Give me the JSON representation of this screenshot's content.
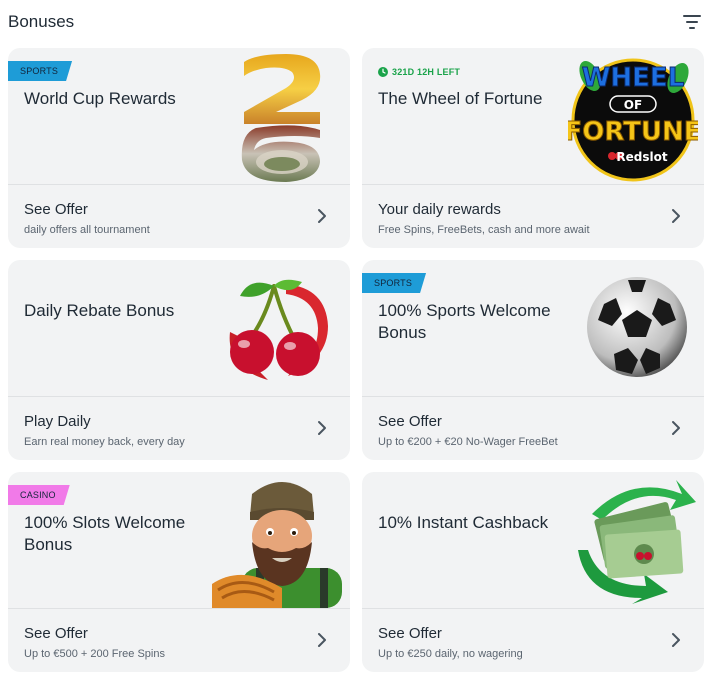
{
  "page": {
    "title": "Bonuses"
  },
  "icons": {
    "filter": "filter-icon",
    "chevron": "chevron-right-icon",
    "clock": "clock-icon"
  },
  "colors": {
    "sports_tag": "#1e9cd7",
    "casino_tag": "#f17ae8",
    "timer": "#1aa34a",
    "card_bg": "#f2f3f4"
  },
  "cards": [
    {
      "tag": "SPORTS",
      "title": "World Cup Rewards",
      "offer": "See Offer",
      "subtitle": "daily offers all tournament",
      "image": "world-cup-26-image"
    },
    {
      "timer": "321D 12H LEFT",
      "title": "The Wheel of Fortune",
      "offer": "Your daily rewards",
      "subtitle": "Free Spins, FreeBets, cash and more await",
      "image": "wheel-of-fortune-logo",
      "logo_text": {
        "line1": "WHEEL",
        "line2": "OF",
        "line3": "FORTUNE",
        "brand": "Redslot"
      }
    },
    {
      "title": "Daily Rebate Bonus",
      "offer": "Play Daily",
      "subtitle": "Earn real money back, every day",
      "image": "cherries-image"
    },
    {
      "tag": "SPORTS",
      "title": "100% Sports Welcome Bonus",
      "offer": "See Offer",
      "subtitle": "Up to €200 + €20 No-Wager FreeBet",
      "image": "soccer-ball-image"
    },
    {
      "tag": "CASINO",
      "title": "100% Slots Welcome Bonus",
      "offer": "See Offer",
      "subtitle": "Up to €500 + 200 Free Spins",
      "image": "bearded-character-image"
    },
    {
      "title": "10% Instant Cashback",
      "offer": "See Offer",
      "subtitle": "Up to €250 daily, no wagering",
      "image": "cashback-money-image"
    }
  ]
}
